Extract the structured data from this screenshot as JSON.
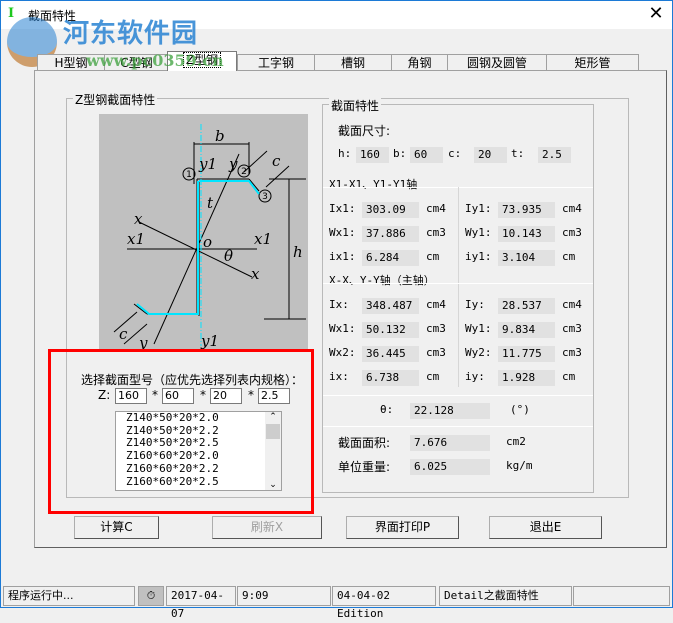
{
  "window": {
    "title": "截面特性",
    "icon": "I",
    "close": "✕"
  },
  "watermark": {
    "text": "河东软件园",
    "url": "www.pc0359.cn"
  },
  "tabs": [
    "H型钢",
    "C型钢",
    "Z型钢",
    "工字钢",
    "槽钢",
    "角钢",
    "圆钢及圆管",
    "矩形管"
  ],
  "group_title": "Z型钢截面特性",
  "diagram": {
    "b": "b",
    "c": "c",
    "t": "t",
    "h": "h",
    "x": "x",
    "x1": "x1",
    "y": "y",
    "y1": "y1",
    "o": "o",
    "theta": "θ",
    "p1": "1",
    "p2": "2",
    "p3": "3"
  },
  "select": {
    "label": "选择截面型号（应优先选择列表内规格）：",
    "prefix": "Z:",
    "star": "*",
    "inputs": [
      "160",
      "60",
      "20",
      "2.5"
    ],
    "list": [
      "Z140*50*20*2.0",
      "Z140*50*20*2.2",
      "Z140*50*20*2.5",
      "Z160*60*20*2.0",
      "Z160*60*20*2.2",
      "Z160*60*20*2.5"
    ]
  },
  "props": {
    "title": "截面特性",
    "dim_title": "截面尺寸:",
    "dims": [
      {
        "l": "h:",
        "v": "160"
      },
      {
        "l": "b:",
        "v": "60"
      },
      {
        "l": "c:",
        "v": "20"
      },
      {
        "l": "t:",
        "v": "2.5"
      }
    ],
    "sec1": "X1-X1、Y1-Y1轴",
    "s1left": [
      {
        "l": "Ix1:",
        "v": "303.09",
        "u": "cm4"
      },
      {
        "l": "Wx1:",
        "v": "37.886",
        "u": "cm3"
      },
      {
        "l": "ix1:",
        "v": "6.284",
        "u": "cm"
      }
    ],
    "s1right": [
      {
        "l": "Iy1:",
        "v": "73.935",
        "u": "cm4"
      },
      {
        "l": "Wy1:",
        "v": "10.143",
        "u": "cm3"
      },
      {
        "l": "iy1:",
        "v": "3.104",
        "u": "cm"
      }
    ],
    "sec2": "X-X、Y-Y轴（主轴）",
    "s2left": [
      {
        "l": "Ix:",
        "v": "348.487",
        "u": "cm4"
      },
      {
        "l": "Wx1:",
        "v": "50.132",
        "u": "cm3"
      },
      {
        "l": "Wx2:",
        "v": "36.445",
        "u": "cm3"
      },
      {
        "l": "ix:",
        "v": "6.738",
        "u": "cm"
      }
    ],
    "s2right": [
      {
        "l": "Iy:",
        "v": "28.537",
        "u": "cm4"
      },
      {
        "l": "Wy1:",
        "v": "9.834",
        "u": "cm3"
      },
      {
        "l": "Wy2:",
        "v": "11.775",
        "u": "cm3"
      },
      {
        "l": "iy:",
        "v": "1.928",
        "u": "cm"
      }
    ],
    "theta": {
      "l": "θ:",
      "v": "22.128",
      "u": "(°)"
    },
    "area": {
      "l": "截面面积:",
      "v": "7.676",
      "u": "cm2"
    },
    "weight": {
      "l": "单位重量:",
      "v": "6.025",
      "u": "kg/m"
    }
  },
  "buttons": {
    "calc": "计算C",
    "refresh": "刷新X",
    "print": "界面打印P",
    "exit": "退出E"
  },
  "status": {
    "msg": "程序运行中...",
    "date": "2017-04-07",
    "time": "9:09",
    "edition": "04-04-02 Edition",
    "detail": "Detail之截面特性"
  },
  "colors": {
    "highlight": "#ff0000",
    "section": "#00e5ff"
  }
}
